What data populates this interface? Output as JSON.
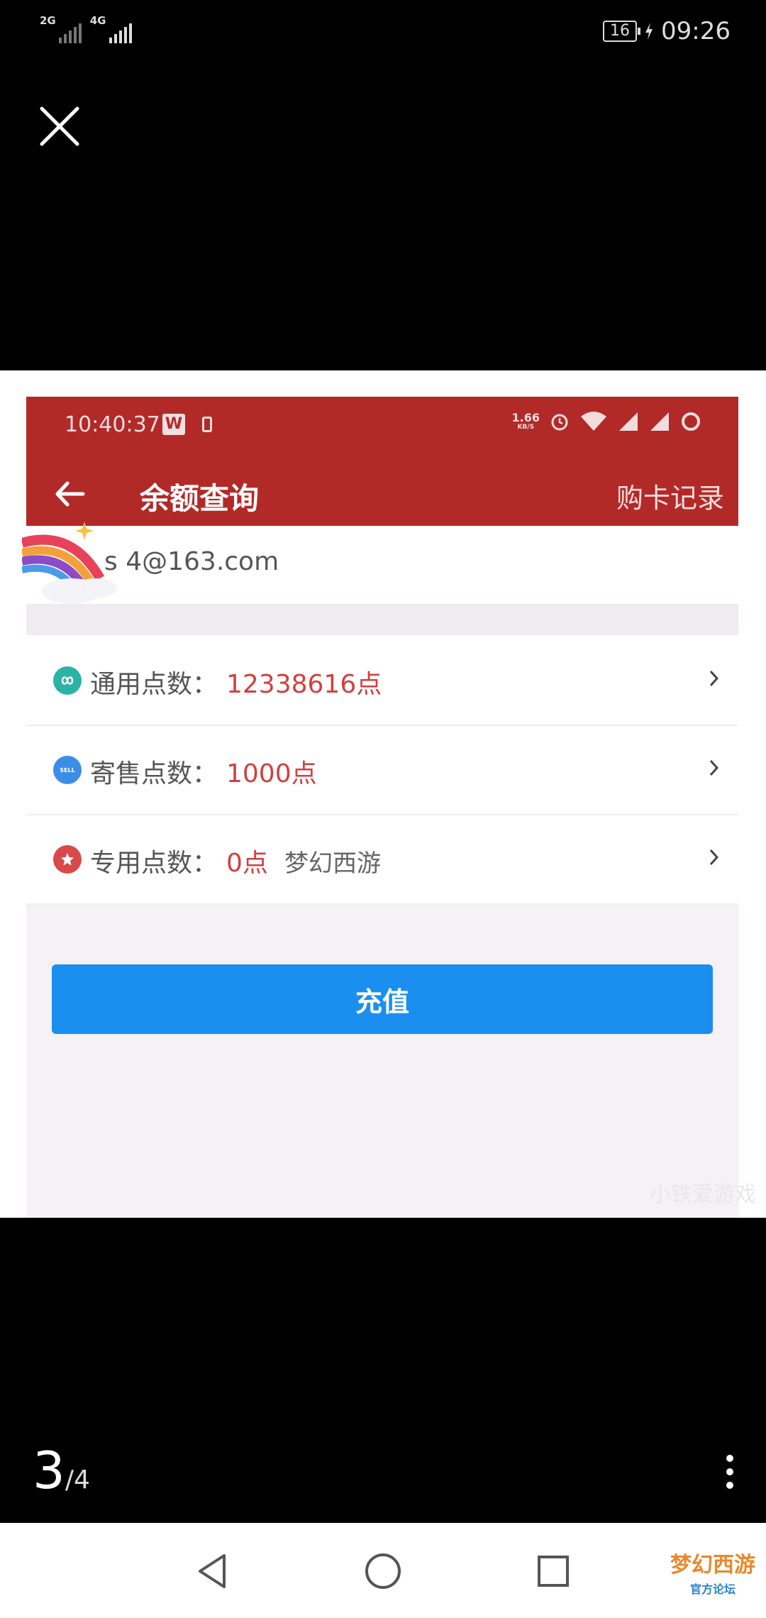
{
  "status_bar": {
    "network1": "2G",
    "network2": "4G",
    "battery": "16",
    "time": "09:26"
  },
  "viewer": {
    "page_current": "3",
    "page_total": "/4"
  },
  "screenshot": {
    "status_time": "10:40:37",
    "w_badge": "W",
    "speed_value": "1.66",
    "speed_unit": "KB/S",
    "title": "余额查询",
    "action": "购卡记录",
    "email": "s    4@163.com",
    "rows": [
      {
        "label": "通用点数：",
        "value": "12338616点",
        "extra": "",
        "icon": "infinity-icon",
        "color": "#2bb3a6"
      },
      {
        "label": "寄售点数：",
        "value": "1000点",
        "extra": "",
        "icon": "sell-icon",
        "color": "#3a8ee6",
        "icon_text": "SELL"
      },
      {
        "label": "专用点数：",
        "value": "0点",
        "extra": "梦幻西游",
        "icon": "game-icon",
        "color": "#d84a4a"
      }
    ],
    "recharge_label": "充值",
    "watermark": "小铁爱游戏"
  },
  "logo": {
    "top": "梦幻西游",
    "bottom": "官方论坛"
  }
}
